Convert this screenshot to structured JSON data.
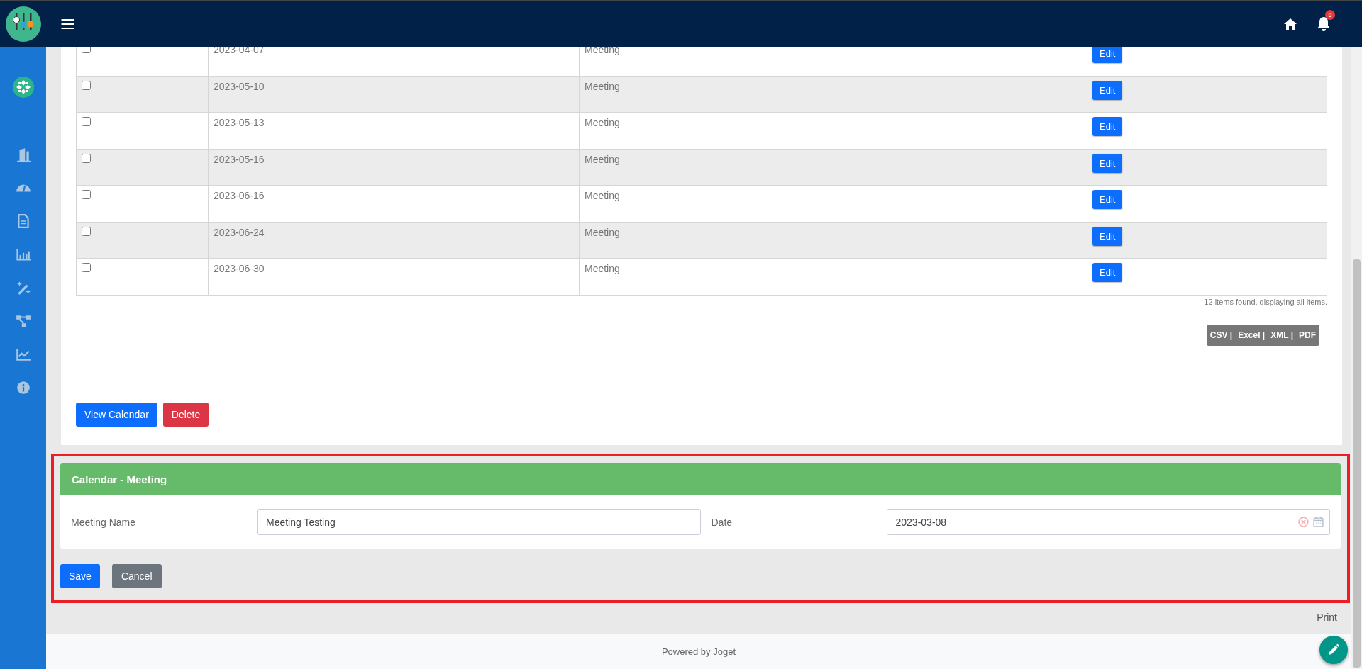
{
  "header": {
    "notification_count": "0"
  },
  "table": {
    "rows": [
      {
        "checked": false,
        "date": "2023-04-07",
        "type": "Meeting",
        "action": "Edit"
      },
      {
        "checked": false,
        "date": "2023-05-10",
        "type": "Meeting",
        "action": "Edit"
      },
      {
        "checked": false,
        "date": "2023-05-13",
        "type": "Meeting",
        "action": "Edit"
      },
      {
        "checked": false,
        "date": "2023-05-16",
        "type": "Meeting",
        "action": "Edit"
      },
      {
        "checked": false,
        "date": "2023-06-16",
        "type": "Meeting",
        "action": "Edit"
      },
      {
        "checked": false,
        "date": "2023-06-24",
        "type": "Meeting",
        "action": "Edit"
      },
      {
        "checked": false,
        "date": "2023-06-30",
        "type": "Meeting",
        "action": "Edit"
      }
    ],
    "summary": "12 items found, displaying all items."
  },
  "export": [
    "CSV |",
    "Excel |",
    "XML |",
    "PDF"
  ],
  "list_buttons": [
    {
      "label": "View Calendar",
      "kind": "primary"
    },
    {
      "label": "Delete",
      "kind": "danger"
    }
  ],
  "form": {
    "highlighted": true,
    "title": "Calendar - Meeting",
    "fields": [
      {
        "label": "Meeting Name",
        "value": "Meeting Testing",
        "kind": "text"
      },
      {
        "label": "Date",
        "value": "2023-03-08",
        "kind": "date"
      }
    ],
    "buttons": [
      {
        "label": "Save",
        "kind": "primary"
      },
      {
        "label": "Cancel",
        "kind": "secondary"
      }
    ]
  },
  "print": "Print",
  "footer": "Powered by Joget"
}
